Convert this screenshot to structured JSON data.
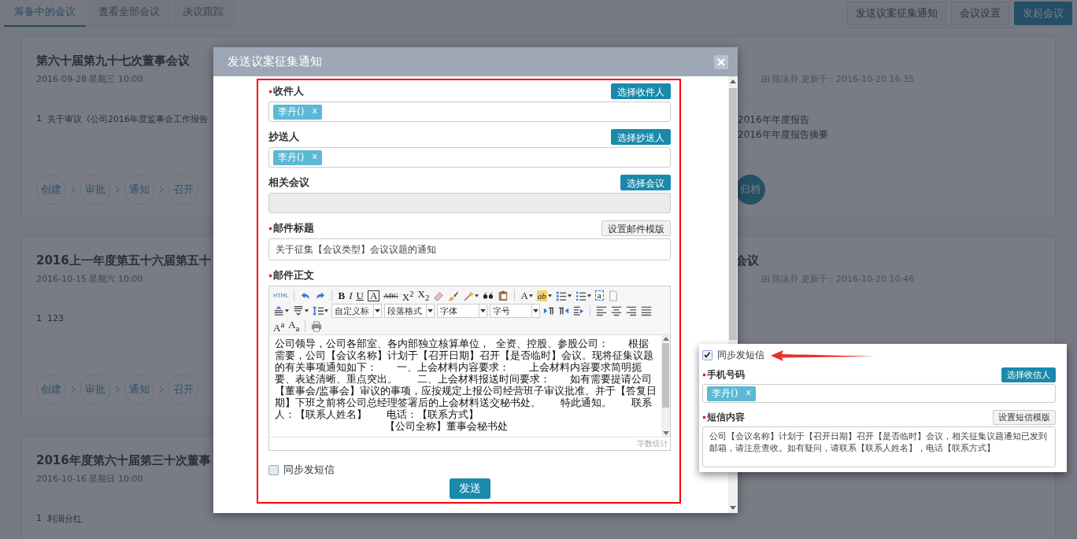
{
  "tabs": [
    {
      "label": "筹备中的会议",
      "selected": true
    },
    {
      "label": "查看全部会议",
      "selected": false
    },
    {
      "label": "决议跟踪",
      "selected": false
    }
  ],
  "actions": [
    {
      "label": "发送议案征集通知",
      "primary": false
    },
    {
      "label": "会议设置",
      "primary": false
    },
    {
      "label": "发起会议",
      "primary": true
    }
  ],
  "meetings": [
    {
      "title": "第六十届第九十七次董事会议",
      "date": "2016-09-28 星期三 10:00",
      "meta": "由 陈泳乔 更新于：2016-10-20 16:35",
      "agenda": [
        {
          "no": "1",
          "text": "关于审议《公司2016年度监事会工作报告"
        }
      ],
      "agenda_right": [
        "2016年年度报告",
        "2016年年度报告摘要"
      ],
      "steps": [
        {
          "label": "创建",
          "done": false
        },
        {
          "label": "审批",
          "done": false
        },
        {
          "label": "通知",
          "done": false
        },
        {
          "label": "召开",
          "done": false
        }
      ],
      "steps_right": [
        {
          "label": "归档",
          "done": true
        }
      ]
    },
    {
      "title": "2016上一年度第五十六届第五十",
      "title_right": "会议",
      "date": "2016-10-15 星期六 10:00",
      "meta": "由 陈泳乔 更新于：2016-10-20 10:46",
      "agenda": [
        {
          "no": "1",
          "text": "123"
        }
      ],
      "steps": [
        {
          "label": "创建",
          "done": false
        },
        {
          "label": "审批",
          "done": false
        },
        {
          "label": "通知",
          "done": false
        },
        {
          "label": "召开",
          "done": false
        }
      ]
    },
    {
      "title": "2016年度第六十届第三十次董事",
      "date": "2016-10-16 星期日 10:00",
      "agenda": [
        {
          "no": "1",
          "text": "利润分红"
        }
      ]
    }
  ],
  "modal": {
    "title": "发送议案征集通知",
    "fields": [
      {
        "kind": "tags",
        "label": "收件人",
        "required": true,
        "button": "选择收件人",
        "button_primary": true,
        "disabled": false,
        "tags": [
          {
            "label": "李丹()",
            "remove": "x"
          }
        ]
      },
      {
        "kind": "tags",
        "label": "抄送人",
        "required": false,
        "button": "选择抄送人",
        "button_primary": true,
        "disabled": false,
        "tags": [
          {
            "label": "李丹()",
            "remove": "x"
          }
        ]
      },
      {
        "kind": "tags",
        "label": "相关会议",
        "required": false,
        "button": "选择会议",
        "button_primary": true,
        "disabled": true
      },
      {
        "kind": "input",
        "label": "邮件标题",
        "required": true,
        "button": "设置邮件模版",
        "button_primary": false,
        "disabled": false,
        "value": "关于征集【会议类型】会议议题的通知"
      },
      {
        "kind": "editor",
        "label": "邮件正文",
        "required": true,
        "disabled": false,
        "toolbar": [
          [
            {
              "kind": "source",
              "text": "HTML"
            },
            {
              "kind": "sep"
            },
            {
              "kind": "undo"
            },
            {
              "kind": "redo"
            },
            {
              "kind": "sep"
            },
            {
              "kind": "bold",
              "text": "B"
            },
            {
              "kind": "italic",
              "text": "I"
            },
            {
              "kind": "underline",
              "text": "U"
            },
            {
              "kind": "boxed",
              "text": "A"
            },
            {
              "kind": "strike",
              "text": "ABC"
            },
            {
              "kind": "plain",
              "text": "X$^{2}$"
            },
            {
              "kind": "plain",
              "text": "X$_{2}$"
            },
            {
              "kind": "eraser"
            },
            {
              "kind": "brush"
            },
            {
              "kind": "magic",
              "dropdown": true
            },
            {
              "kind": "quote"
            },
            {
              "kind": "paste"
            },
            {
              "kind": "sep"
            },
            {
              "kind": "plain",
              "text": "A",
              "dropdown": true
            },
            {
              "kind": "highlight",
              "text": "ab",
              "dropdown": true
            },
            {
              "kind": "ol",
              "dropdown": true
            },
            {
              "kind": "ul",
              "dropdown": true
            },
            {
              "kind": "anchor",
              "text": "a"
            },
            {
              "kind": "page"
            }
          ],
          [
            {
              "kind": "space-top",
              "dropdown": true
            },
            {
              "kind": "space-bottom",
              "dropdown": true
            },
            {
              "kind": "line-height",
              "dropdown": true
            },
            {
              "kind": "select",
              "text": "自定义标"
            },
            {
              "kind": "select",
              "text": "段落格式"
            },
            {
              "kind": "select",
              "text": "字体"
            },
            {
              "kind": "select",
              "text": "字号"
            },
            {
              "kind": "ltr"
            },
            {
              "kind": "rtl"
            },
            {
              "kind": "indent"
            },
            {
              "kind": "sep"
            },
            {
              "kind": "align-left"
            },
            {
              "kind": "align-center"
            },
            {
              "kind": "align-right"
            },
            {
              "kind": "align-justify"
            }
          ],
          [
            {
              "kind": "plain",
              "text": "A$^{a}$"
            },
            {
              "kind": "plain",
              "text": "A$_{a}$"
            },
            {
              "kind": "sep"
            },
            {
              "kind": "print"
            }
          ]
        ],
        "body": [
          "公司领导，公司各部室、各内部独立核算单位，  全资、控股、参股公司：      根据需要，公司【会议名称】计划于【召开日期】召开【是否临时】会议。现将征集议题的有关事项通知如下：      一、上会材料内容要求：      上会材料内容要求简明扼要、表述清晰、重点突出。      二、上会材料报送时间要求：      如有需要提请公司【董事会/监事会】审议的事项，应按规定上报公司经营班子审议批准。并于【答复日期】下班之前将公司总经理签署后的上会材料送交秘书处。      特此通知。      联系人：【联系人姓名】      电话：【联系方式】",
          "【公司全称】董事会秘书处"
        ],
        "footer": "字数统计"
      }
    ],
    "sms": {
      "label": "同步发短信",
      "checked": false
    },
    "submit": "发送"
  },
  "callout": {
    "sms": {
      "label": "同步发短信",
      "checked": true
    },
    "fields": [
      {
        "kind": "tags",
        "label": "手机号码",
        "required": true,
        "button": "选择收信人",
        "button_primary": true,
        "disabled": false,
        "tags": [
          {
            "label": "李丹()",
            "remove": "x"
          }
        ]
      },
      {
        "kind": "textarea",
        "label": "短信内容",
        "required": true,
        "button": "设置短信模版",
        "button_primary": false,
        "disabled": false,
        "value": "公司【会议名称】计划于【召开日期】召开【是否临时】会议，相关征集议题通知已发到邮箱，请注意查收。如有疑问，请联系【联系人姓名】，电话【联系方式】"
      }
    ]
  }
}
